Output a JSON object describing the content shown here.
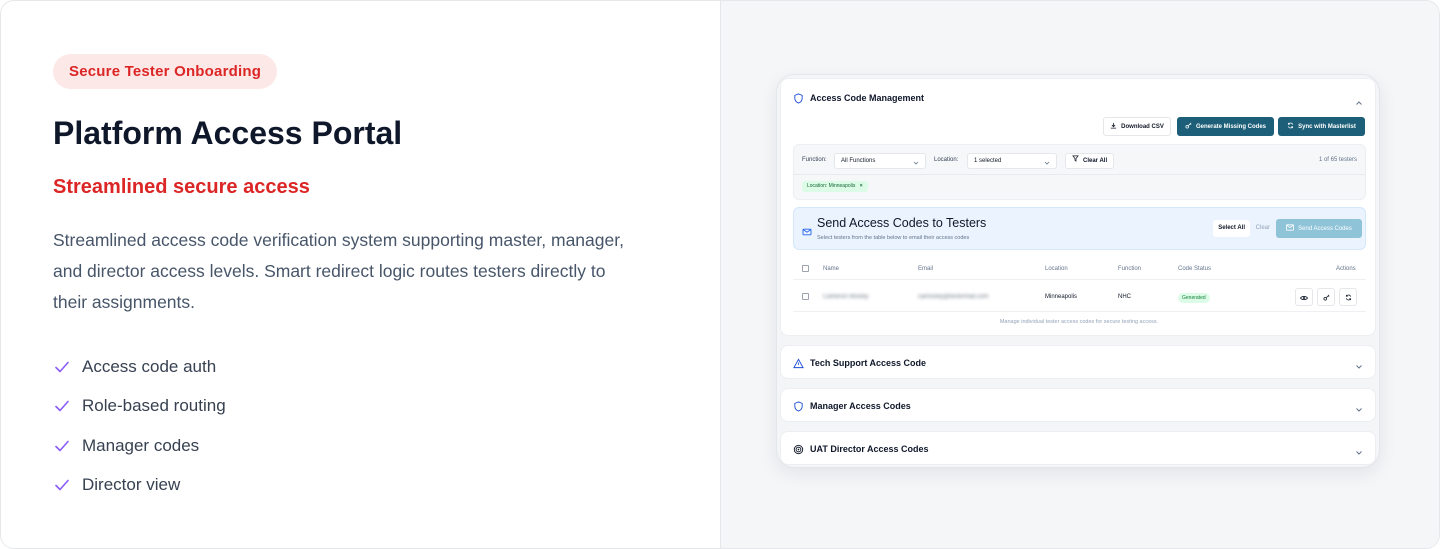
{
  "left": {
    "badge": "Secure Tester Onboarding",
    "title": "Platform Access Portal",
    "subtitle": "Streamlined secure access",
    "description": "Streamlined access code verification system supporting master, manager, and director access levels. Smart redirect logic routes testers directly to their assignments.",
    "features": [
      "Access code auth",
      "Role-based routing",
      "Manager codes",
      "Director view"
    ]
  },
  "app": {
    "management": {
      "title": "Access Code Management",
      "download_csv": "Download CSV",
      "generate_missing": "Generate Missing Codes",
      "sync_masterlist": "Sync with Masterlist"
    },
    "filters": {
      "function_label": "Function:",
      "function_value": "All Functions",
      "location_label": "Location:",
      "location_value": "1 selected",
      "clear_all": "Clear All",
      "count": "1 of 65 testers",
      "active_chip": "Location: Minneapolis"
    },
    "send": {
      "title": "Send Access Codes to Testers",
      "subtitle": "Select testers from the table below to email their access codes",
      "select_all": "Select All",
      "clear": "Clear",
      "send_button": "Send Access Codes"
    },
    "table": {
      "headers": [
        "Name",
        "Email",
        "Location",
        "Function",
        "Code Status",
        "Actions"
      ],
      "row": {
        "name": "Cameron Mosley",
        "email": "camosley@testermail.com",
        "location": "Minneapolis",
        "function": "NHC",
        "status": "Generated"
      },
      "footer": "Manage individual tester access codes for secure testing access."
    },
    "sections": [
      "Tech Support Access Code",
      "Manager Access Codes",
      "UAT Director Access Codes"
    ]
  },
  "colors": {
    "accent_red": "#dc2626",
    "pill_bg": "#fde8e8",
    "teal_button": "#1d5f78",
    "check_purple": "#7c3aed"
  }
}
